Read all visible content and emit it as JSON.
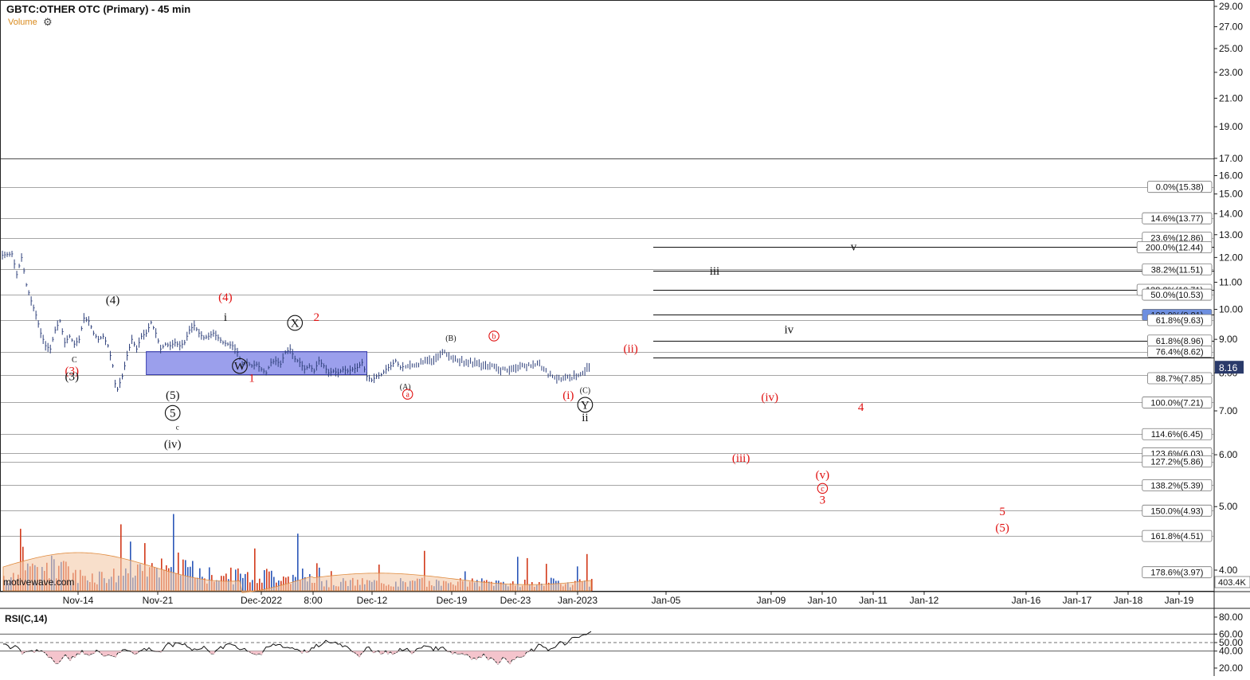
{
  "header": {
    "title": "GBTC:OTHER OTC (Primary) - 45 min",
    "volume_label": "Volume"
  },
  "icons": {
    "settings": "gear-icon"
  },
  "watermark": "motivewave.com",
  "rsi": {
    "label": "RSI(C,14)",
    "ticks": [
      "80.00",
      "60.00",
      "50.00",
      "40.00",
      "20.00"
    ],
    "levels": [
      80,
      60,
      50,
      40,
      20
    ]
  },
  "colors": {
    "price_bar": "#2d3f7a",
    "zone_fill": "#7a7fe6",
    "red_label": "#e01010",
    "volume_red": "#d23a1a",
    "volume_blue": "#2a56b8",
    "volume_ma_fill": "#f3c9a8",
    "rsi_shade": "#f4c4cc"
  },
  "chart_data": {
    "type": "line",
    "title": "GBTC:OTHER OTC (Primary) - 45 min",
    "scale": "log",
    "ylim": [
      3.8,
      29.5
    ],
    "y_ticks": [
      "29.00",
      "27.00",
      "25.00",
      "23.00",
      "21.00",
      "19.00",
      "17.00",
      "16.00",
      "15.00",
      "14.00",
      "13.00",
      "12.00",
      "11.00",
      "10.00",
      "9.00",
      "8.00",
      "7.00",
      "6.00",
      "5.00",
      "4.00"
    ],
    "x_ticks": [
      "Nov-14",
      "Nov-21",
      "Dec-2022",
      "8:00",
      "Dec-12",
      "Dec-19",
      "Dec-23",
      "Jan-2023",
      "Jan-05",
      "Jan-09",
      "Jan-10",
      "Jan-11",
      "Jan-12",
      "Jan-16",
      "Jan-17",
      "Jan-18",
      "Jan-19"
    ],
    "price_path": [
      {
        "t": 0,
        "p": 12.1
      },
      {
        "t": 4,
        "p": 12.15
      },
      {
        "t": 6,
        "p": 11.3
      },
      {
        "t": 8,
        "p": 12.0
      },
      {
        "t": 10,
        "p": 10.9
      },
      {
        "t": 12,
        "p": 10.3
      },
      {
        "t": 14,
        "p": 9.8
      },
      {
        "t": 16,
        "p": 9.2
      },
      {
        "t": 18,
        "p": 8.8
      },
      {
        "t": 20,
        "p": 8.7
      },
      {
        "t": 22,
        "p": 9.3
      },
      {
        "t": 24,
        "p": 9.6
      },
      {
        "t": 26,
        "p": 8.9
      },
      {
        "t": 28,
        "p": 9.1
      },
      {
        "t": 30,
        "p": 8.85
      },
      {
        "t": 32,
        "p": 9.0
      },
      {
        "t": 34,
        "p": 9.7
      },
      {
        "t": 36,
        "p": 9.6
      },
      {
        "t": 38,
        "p": 9.2
      },
      {
        "t": 40,
        "p": 9.0
      },
      {
        "t": 42,
        "p": 9.1
      },
      {
        "t": 44,
        "p": 8.8
      },
      {
        "t": 46,
        "p": 8.2
      },
      {
        "t": 47,
        "p": 7.7
      },
      {
        "t": 48,
        "p": 7.55
      },
      {
        "t": 50,
        "p": 7.9
      },
      {
        "t": 52,
        "p": 8.5
      },
      {
        "t": 54,
        "p": 9.0
      },
      {
        "t": 56,
        "p": 8.7
      },
      {
        "t": 58,
        "p": 9.1
      },
      {
        "t": 60,
        "p": 9.2
      },
      {
        "t": 62,
        "p": 9.55
      },
      {
        "t": 64,
        "p": 9.2
      },
      {
        "t": 66,
        "p": 8.7
      },
      {
        "t": 68,
        "p": 8.85
      },
      {
        "t": 70,
        "p": 8.8
      },
      {
        "t": 72,
        "p": 8.9
      },
      {
        "t": 74,
        "p": 8.8
      },
      {
        "t": 76,
        "p": 8.9
      },
      {
        "t": 78,
        "p": 9.3
      },
      {
        "t": 80,
        "p": 9.45
      },
      {
        "t": 82,
        "p": 9.2
      },
      {
        "t": 84,
        "p": 9.05
      },
      {
        "t": 86,
        "p": 9.1
      },
      {
        "t": 88,
        "p": 9.2
      },
      {
        "t": 90,
        "p": 9.05
      },
      {
        "t": 92,
        "p": 8.9
      },
      {
        "t": 94,
        "p": 8.85
      },
      {
        "t": 96,
        "p": 8.8
      },
      {
        "t": 98,
        "p": 8.6
      },
      {
        "t": 100,
        "p": 8.25
      },
      {
        "t": 102,
        "p": 8.3
      },
      {
        "t": 104,
        "p": 8.2
      },
      {
        "t": 106,
        "p": 8.25
      },
      {
        "t": 108,
        "p": 8.1
      },
      {
        "t": 110,
        "p": 8.0
      },
      {
        "t": 112,
        "p": 8.3
      },
      {
        "t": 114,
        "p": 8.35
      },
      {
        "t": 116,
        "p": 8.25
      },
      {
        "t": 118,
        "p": 8.6
      },
      {
        "t": 120,
        "p": 8.7
      },
      {
        "t": 122,
        "p": 8.4
      },
      {
        "t": 124,
        "p": 8.3
      },
      {
        "t": 126,
        "p": 8.1
      },
      {
        "t": 128,
        "p": 8.2
      },
      {
        "t": 130,
        "p": 8.05
      },
      {
        "t": 132,
        "p": 8.35
      },
      {
        "t": 134,
        "p": 8.2
      },
      {
        "t": 136,
        "p": 8.0
      },
      {
        "t": 138,
        "p": 8.05
      },
      {
        "t": 140,
        "p": 8.0
      },
      {
        "t": 142,
        "p": 8.1
      },
      {
        "t": 144,
        "p": 8.05
      },
      {
        "t": 146,
        "p": 8.1
      },
      {
        "t": 148,
        "p": 8.15
      },
      {
        "t": 150,
        "p": 8.3
      },
      {
        "t": 152,
        "p": 7.9
      },
      {
        "t": 154,
        "p": 7.8
      },
      {
        "t": 156,
        "p": 7.9
      },
      {
        "t": 158,
        "p": 7.95
      },
      {
        "t": 160,
        "p": 8.1
      },
      {
        "t": 162,
        "p": 8.2
      },
      {
        "t": 164,
        "p": 8.35
      },
      {
        "t": 166,
        "p": 8.15
      },
      {
        "t": 168,
        "p": 8.2
      }
    ],
    "elliott_zone": {
      "start_t": 60,
      "end_t": 152,
      "low": 7.95,
      "high": 8.62
    },
    "hlines": [
      {
        "price": 17.0,
        "full": true,
        "color": "#111"
      },
      {
        "price": 15.38,
        "full": true,
        "color": "#888"
      },
      {
        "price": 13.77,
        "full": true,
        "color": "#888"
      },
      {
        "price": 12.86,
        "full": true,
        "color": "#888"
      },
      {
        "price": 12.44,
        "full": false,
        "color": "#111"
      },
      {
        "price": 11.51,
        "full": true,
        "color": "#888"
      },
      {
        "price": 11.44,
        "full": false,
        "color": "#111"
      },
      {
        "price": 10.71,
        "full": false,
        "color": "#111"
      },
      {
        "price": 10.53,
        "full": true,
        "color": "#888"
      },
      {
        "price": 9.81,
        "full": false,
        "color": "#111"
      },
      {
        "price": 9.63,
        "full": true,
        "color": "#888"
      },
      {
        "price": 8.96,
        "full": false,
        "color": "#111"
      },
      {
        "price": 8.62,
        "full": true,
        "color": "#888"
      },
      {
        "price": 8.45,
        "full": false,
        "color": "#111"
      },
      {
        "price": 7.95,
        "full": true,
        "color": "#888"
      },
      {
        "price": 7.21,
        "full": true,
        "color": "#888"
      },
      {
        "price": 6.45,
        "full": true,
        "color": "#888"
      },
      {
        "price": 6.03,
        "full": true,
        "color": "#888"
      },
      {
        "price": 5.86,
        "full": true,
        "color": "#888"
      },
      {
        "price": 5.39,
        "full": true,
        "color": "#888"
      },
      {
        "price": 4.93,
        "full": true,
        "color": "#888"
      },
      {
        "price": 4.51,
        "full": true,
        "color": "#888"
      }
    ],
    "fib_labels": [
      {
        "text": "0.0%(15.38)",
        "price": 15.38
      },
      {
        "text": "14.6%(13.77)",
        "price": 13.77
      },
      {
        "text": "23.6%(12.86)",
        "price": 12.86
      },
      {
        "text": "200.0%(12.44)",
        "price": 12.44
      },
      {
        "text": "38.2%(11.51)",
        "price": 11.51
      },
      {
        "text": "138.2%(10.71)",
        "price": 10.71
      },
      {
        "text": "50.0%(10.53)",
        "price": 10.53
      },
      {
        "text": "100.0%(9.81)",
        "price": 9.81,
        "fill": "#6d8fe0"
      },
      {
        "text": "61.8%(9.63)",
        "price": 9.63
      },
      {
        "text": "61.8%(8.96)",
        "price": 8.96
      },
      {
        "text": "76.4%(8.62)",
        "price": 8.62
      },
      {
        "text": "88.7%(7.85)",
        "price": 7.85
      },
      {
        "text": "100.0%(7.21)",
        "price": 7.21
      },
      {
        "text": "114.6%(6.45)",
        "price": 6.45
      },
      {
        "text": "123.6%(6.03)",
        "price": 6.03
      },
      {
        "text": "127.2%(5.86)",
        "price": 5.86
      },
      {
        "text": "138.2%(5.39)",
        "price": 5.39
      },
      {
        "text": "150.0%(4.93)",
        "price": 4.93
      },
      {
        "text": "161.8%(4.51)",
        "price": 4.51
      },
      {
        "text": "178.6%(3.97)",
        "price": 3.97
      }
    ],
    "current_price": "8.16",
    "current_price_value": 8.16,
    "volume_axis_label": "403.4K",
    "wave_labels": [
      {
        "text": "(4)",
        "t": 46,
        "p": 10.2,
        "color": "#111"
      },
      {
        "text": "C",
        "t": 30,
        "p": 8.3,
        "color": "#111",
        "size": 10
      },
      {
        "text": "(3)",
        "t": 29,
        "p": 7.95,
        "color": "#e01010"
      },
      {
        "text": "(3)",
        "t": 29,
        "p": 7.8,
        "color": "#111"
      },
      {
        "text": "(5)",
        "t": 71,
        "p": 7.3,
        "color": "#111"
      },
      {
        "text": "5",
        "t": 71,
        "p": 6.85,
        "color": "#111",
        "circle": true
      },
      {
        "text": "c",
        "t": 73,
        "p": 6.55,
        "color": "#111",
        "size": 9
      },
      {
        "text": "(iv)",
        "t": 71,
        "p": 6.15,
        "color": "#111"
      },
      {
        "text": "(4)",
        "t": 93,
        "p": 10.3,
        "color": "#e01010"
      },
      {
        "text": "i",
        "t": 93,
        "p": 9.6,
        "color": "#111"
      },
      {
        "text": "W",
        "t": 99,
        "p": 8.08,
        "color": "#111",
        "circle": true
      },
      {
        "text": "1",
        "t": 104,
        "p": 7.75,
        "color": "#e01010"
      },
      {
        "text": "X",
        "t": 122,
        "p": 9.4,
        "color": "#111",
        "circle": true
      },
      {
        "text": "2",
        "t": 131,
        "p": 9.6,
        "color": "#e01010"
      },
      {
        "text": "(A)",
        "t": 168,
        "p": 7.55,
        "color": "#111",
        "size": 10
      },
      {
        "text": "a",
        "t": 169,
        "p": 7.35,
        "color": "#e01010",
        "circle": true,
        "size": 10
      },
      {
        "text": "(B)",
        "t": 187,
        "p": 8.95,
        "color": "#111",
        "size": 10
      },
      {
        "text": "b",
        "t": 205,
        "p": 9.02,
        "color": "#e01010",
        "circle": true,
        "size": 10
      },
      {
        "text": "(i)",
        "t": 236,
        "p": 7.3,
        "color": "#e01010"
      },
      {
        "text": "(C)",
        "t": 243,
        "p": 7.45,
        "color": "#111",
        "size": 10
      },
      {
        "text": "Y",
        "t": 243,
        "p": 7.05,
        "color": "#111",
        "circle": true
      },
      {
        "text": "ii",
        "t": 243,
        "p": 6.75,
        "color": "#111"
      },
      {
        "text": "(ii)",
        "t": 262,
        "p": 8.6,
        "color": "#e01010"
      },
      {
        "text": "iii",
        "t": 297,
        "p": 11.3,
        "color": "#111"
      },
      {
        "text": "v",
        "t": 355,
        "p": 12.3,
        "color": "#111"
      },
      {
        "text": "iv",
        "t": 328,
        "p": 9.2,
        "color": "#111"
      },
      {
        "text": "(iv)",
        "t": 320,
        "p": 7.25,
        "color": "#e01010"
      },
      {
        "text": "4",
        "t": 358,
        "p": 7.0,
        "color": "#e01010"
      },
      {
        "text": "(iii)",
        "t": 308,
        "p": 5.85,
        "color": "#e01010"
      },
      {
        "text": "(v)",
        "t": 342,
        "p": 5.52,
        "color": "#e01010"
      },
      {
        "text": "c",
        "t": 342,
        "p": 5.28,
        "color": "#e01010",
        "circle": true,
        "size": 10
      },
      {
        "text": "3",
        "t": 342,
        "p": 5.05,
        "color": "#e01010"
      },
      {
        "text": "5",
        "t": 417,
        "p": 4.85,
        "color": "#e01010"
      },
      {
        "text": "(5)",
        "t": 417,
        "p": 4.58,
        "color": "#e01010"
      }
    ]
  }
}
